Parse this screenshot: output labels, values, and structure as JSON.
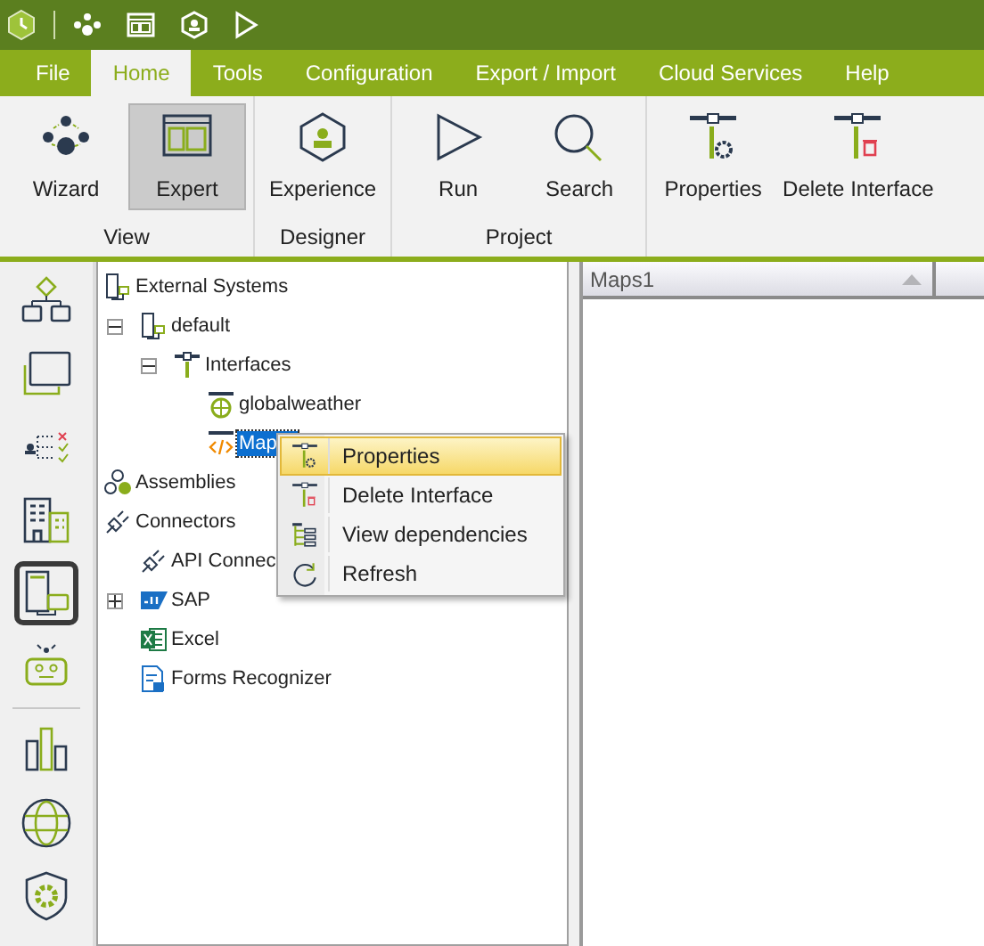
{
  "menu_tabs": [
    {
      "label": "File",
      "selected": false
    },
    {
      "label": "Home",
      "selected": true
    },
    {
      "label": "Tools",
      "selected": false
    },
    {
      "label": "Configuration",
      "selected": false
    },
    {
      "label": "Export / Import",
      "selected": false
    },
    {
      "label": "Cloud Services",
      "selected": false
    },
    {
      "label": "Help",
      "selected": false
    }
  ],
  "ribbon_groups": [
    {
      "label": "View",
      "buttons": [
        {
          "label": "Wizard",
          "kind": "wizard",
          "selected": false
        },
        {
          "label": "Expert",
          "kind": "expert",
          "selected": true
        }
      ]
    },
    {
      "label": "Designer",
      "buttons": [
        {
          "label": "Experience",
          "kind": "experience",
          "selected": false
        }
      ]
    },
    {
      "label": "Project",
      "buttons": [
        {
          "label": "Run",
          "kind": "run",
          "selected": false
        },
        {
          "label": "Search",
          "kind": "search",
          "selected": false
        }
      ]
    },
    {
      "buttons": [
        {
          "label": "Properties",
          "kind": "properties",
          "selected": false
        },
        {
          "label": "Delete Interface",
          "kind": "delete",
          "selected": false
        }
      ]
    }
  ],
  "sidebar": [
    {
      "kind": "flow",
      "selected": false
    },
    {
      "kind": "window",
      "selected": false
    },
    {
      "kind": "rules",
      "selected": false
    },
    {
      "kind": "buildings",
      "selected": false
    },
    {
      "kind": "devices",
      "selected": true
    },
    {
      "kind": "robot",
      "selected": false
    },
    {
      "kind": "chart",
      "selected": false
    },
    {
      "kind": "globe",
      "selected": false
    },
    {
      "kind": "shield",
      "selected": false
    }
  ],
  "tree": [
    {
      "label": "External Systems",
      "kind": "system",
      "selected": false,
      "children": [
        {
          "label": "default",
          "kind": "system",
          "selected": false,
          "expanded": true,
          "children": [
            {
              "label": "Interfaces",
              "kind": "interfaces",
              "selected": false,
              "expanded": true,
              "children": [
                {
                  "label": "globalweather",
                  "kind": "web",
                  "selected": false
                },
                {
                  "label": "Map",
                  "kind": "code",
                  "selected": true
                }
              ]
            }
          ]
        }
      ]
    },
    {
      "label": "Assemblies",
      "kind": "assemblies",
      "selected": false
    },
    {
      "label": "Connectors",
      "kind": "plug",
      "selected": false,
      "children": [
        {
          "label": "API Connec",
          "kind": "plug",
          "selected": false
        },
        {
          "label": "SAP",
          "kind": "sap",
          "selected": false,
          "expanded": false
        },
        {
          "label": "Excel",
          "kind": "excel",
          "selected": false
        },
        {
          "label": "Forms Recognizer",
          "kind": "forms",
          "selected": false
        }
      ]
    }
  ],
  "context_menu": [
    {
      "label": "Properties",
      "kind": "properties",
      "selected": true
    },
    {
      "label": "Delete Interface",
      "kind": "delete",
      "selected": false
    },
    {
      "label": "View dependencies",
      "kind": "dependencies",
      "selected": false
    },
    {
      "label": "Refresh",
      "kind": "refresh",
      "selected": false
    }
  ],
  "grid": {
    "columns": [
      {
        "label": "Maps1"
      }
    ]
  }
}
